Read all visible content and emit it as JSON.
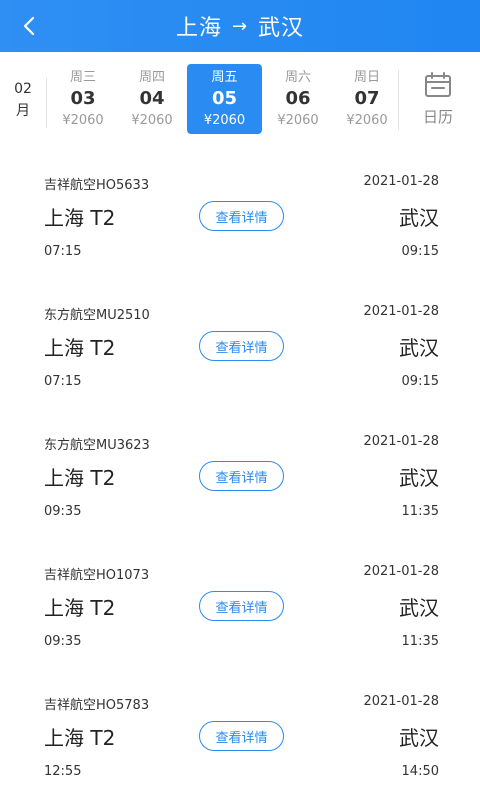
{
  "header": {
    "origin": "上海",
    "arrow": "→",
    "destination": "武汉"
  },
  "datebar": {
    "month_num": "02",
    "month_unit": "月",
    "days": [
      {
        "weekday": "周三",
        "day": "03",
        "price": "¥2060"
      },
      {
        "weekday": "周四",
        "day": "04",
        "price": "¥2060"
      },
      {
        "weekday": "周五",
        "day": "05",
        "price": "¥2060"
      },
      {
        "weekday": "周六",
        "day": "06",
        "price": "¥2060"
      },
      {
        "weekday": "周日",
        "day": "07",
        "price": "¥2060"
      }
    ],
    "selected_index": 2,
    "calendar_label": "日历"
  },
  "flights": [
    {
      "airline": "吉祥航空HO5633",
      "date": "2021-01-28",
      "from": "上海 T2",
      "to": "武汉",
      "dep_time": "07:15",
      "arr_time": "09:15",
      "detail_label": "查看详情"
    },
    {
      "airline": "东方航空MU2510",
      "date": "2021-01-28",
      "from": "上海 T2",
      "to": "武汉",
      "dep_time": "07:15",
      "arr_time": "09:15",
      "detail_label": "查看详情"
    },
    {
      "airline": "东方航空MU3623",
      "date": "2021-01-28",
      "from": "上海 T2",
      "to": "武汉",
      "dep_time": "09:35",
      "arr_time": "11:35",
      "detail_label": "查看详情"
    },
    {
      "airline": "吉祥航空HO1073",
      "date": "2021-01-28",
      "from": "上海 T2",
      "to": "武汉",
      "dep_time": "09:35",
      "arr_time": "11:35",
      "detail_label": "查看详情"
    },
    {
      "airline": "吉祥航空HO5783",
      "date": "2021-01-28",
      "from": "上海 T2",
      "to": "武汉",
      "dep_time": "12:55",
      "arr_time": "14:50",
      "detail_label": "查看详情"
    }
  ],
  "icons": {
    "back": "chevron-left-icon",
    "calendar": "calendar-icon"
  },
  "colors": {
    "header_bg": "#2a8bf2",
    "accent": "#2a8bf2",
    "muted": "#9a9a9a"
  }
}
